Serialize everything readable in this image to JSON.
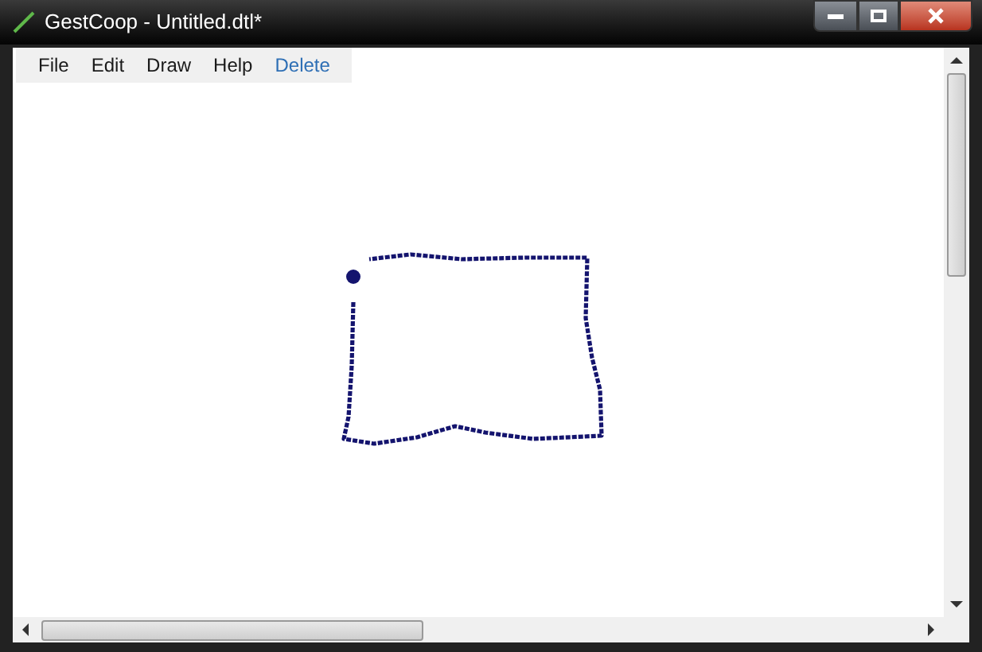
{
  "window": {
    "title": "GestCoop - Untitled.dtl*"
  },
  "menu": [
    {
      "label": "File",
      "kind": "menu"
    },
    {
      "label": "Edit",
      "kind": "menu"
    },
    {
      "label": "Draw",
      "kind": "menu"
    },
    {
      "label": "Help",
      "kind": "menu"
    },
    {
      "label": "Delete",
      "kind": "action"
    }
  ]
}
